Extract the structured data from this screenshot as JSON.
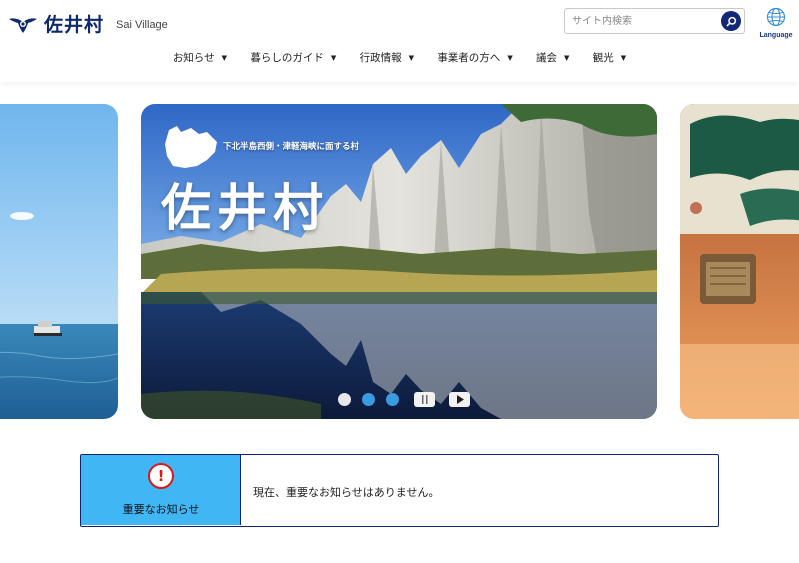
{
  "header": {
    "logo_text": "佐井村",
    "logo_sub": "Sai Village",
    "search_placeholder": "サイト内検索",
    "language_label": "Language"
  },
  "nav": {
    "items": [
      {
        "label": "お知らせ"
      },
      {
        "label": "暮らしのガイド"
      },
      {
        "label": "行政情報"
      },
      {
        "label": "事業者の方へ"
      },
      {
        "label": "議会"
      },
      {
        "label": "観光"
      }
    ]
  },
  "hero": {
    "tagline": "下北半島西側・津軽海峡に面する村",
    "title": "佐井村",
    "slide_count": 3,
    "active_slide": 1
  },
  "notice": {
    "title": "重要なお知らせ",
    "icon": "!",
    "message": "現在、重要なお知らせはありません。"
  },
  "colors": {
    "brand_navy": "#0d2a6e",
    "notice_blue": "#40b6f5",
    "alert_red": "#d81a1a",
    "dot_blue": "#3b9be0"
  }
}
